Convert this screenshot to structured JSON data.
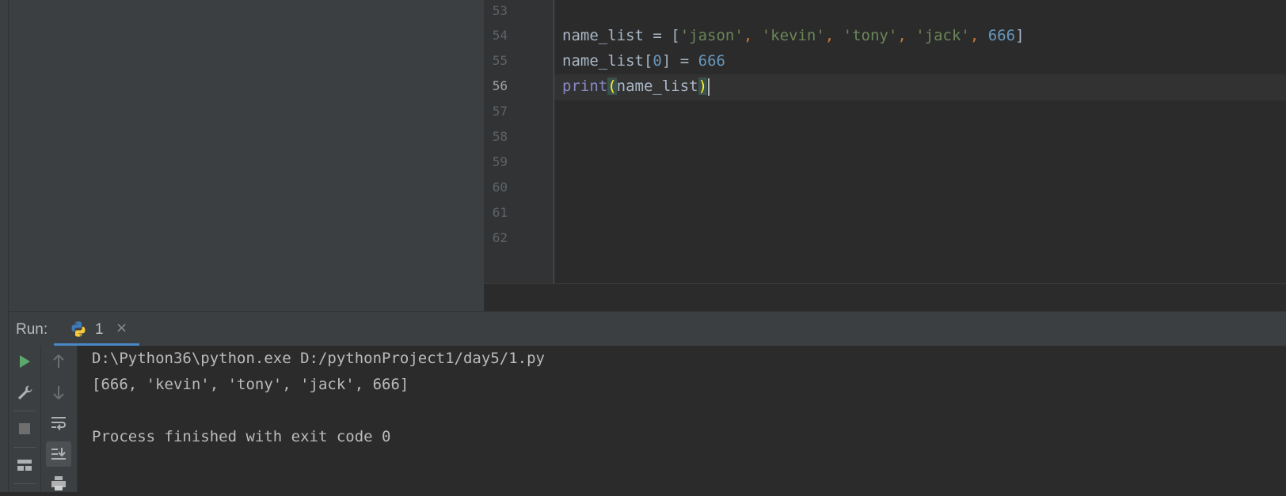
{
  "editor": {
    "line_numbers": [
      "53",
      "54",
      "55",
      "56",
      "57",
      "58",
      "59",
      "60",
      "61",
      "62"
    ],
    "current_line": "56",
    "code": {
      "line54": {
        "var": "name_list",
        "eq": " = ",
        "open": "[",
        "s1": "'jason'",
        "s2": "'kevin'",
        "s3": "'tony'",
        "s4": "'jack'",
        "n1": "666",
        "close": "]"
      },
      "line55": {
        "var": "name_list",
        "open": "[",
        "idx": "0",
        "close": "]",
        "eq": " = ",
        "val": "666"
      },
      "line56": {
        "fn": "print",
        "open": "(",
        "arg": "name_list",
        "close": ")"
      },
      "comma": ", "
    }
  },
  "run_panel": {
    "label": "Run:",
    "tab": {
      "label": "1",
      "icon": "python-icon",
      "close": "×"
    },
    "console": [
      "D:\\Python36\\python.exe D:/pythonProject1/day5/1.py",
      "[666, 'kevin', 'tony', 'jack', 666]",
      "",
      "Process finished with exit code 0"
    ]
  },
  "colors": {
    "editor_bg": "#2b2b2b",
    "panel_bg": "#3c3f41",
    "string": "#6a8759",
    "number": "#6897bb",
    "keyword_comma": "#cc7832",
    "builtin": "#8888c6",
    "run_green": "#59a869"
  }
}
